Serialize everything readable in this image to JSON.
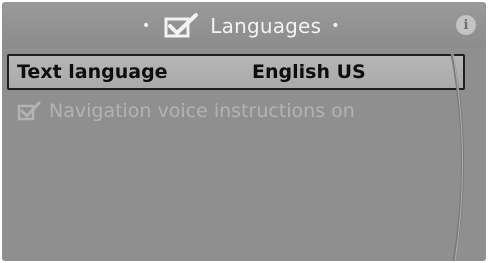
{
  "header": {
    "title": "Languages",
    "dot_left": "•",
    "dot_right": "•",
    "info_label": "i"
  },
  "list": {
    "items": [
      {
        "label": "Text language",
        "value": "English US",
        "selected": true,
        "enabled": true
      },
      {
        "label": "Navigation voice instructions on",
        "checked": true,
        "enabled": false
      }
    ]
  },
  "colors": {
    "screen_background": "#8f8f8f",
    "selection_border": "#1e1e1e",
    "text_enabled": "#0d0d0d",
    "text_disabled": "#b3b3b3",
    "title_text": "#f3f3f3"
  },
  "icons": {
    "title": "checkbox-tick-icon",
    "info": "info-icon",
    "item_checkbox": "checked-box-icon"
  }
}
